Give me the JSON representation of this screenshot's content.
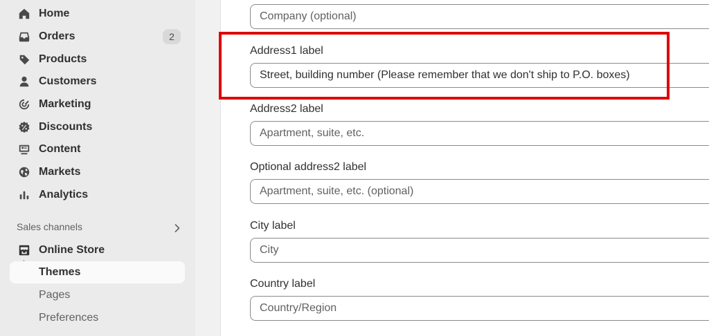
{
  "sidebar": {
    "items": [
      {
        "label": "Home",
        "icon": "home-icon"
      },
      {
        "label": "Orders",
        "icon": "inbox-icon",
        "badge": "2"
      },
      {
        "label": "Products",
        "icon": "tag-icon"
      },
      {
        "label": "Customers",
        "icon": "person-icon"
      },
      {
        "label": "Marketing",
        "icon": "target-icon"
      },
      {
        "label": "Discounts",
        "icon": "discount-icon"
      },
      {
        "label": "Content",
        "icon": "content-icon"
      },
      {
        "label": "Markets",
        "icon": "globe-icon"
      },
      {
        "label": "Analytics",
        "icon": "bar-chart-icon"
      }
    ],
    "sales_channels_label": "Sales channels",
    "online_store_label": "Online Store",
    "sub_items": [
      {
        "label": "Themes",
        "active": true
      },
      {
        "label": "Pages",
        "active": false
      },
      {
        "label": "Preferences",
        "active": false
      }
    ]
  },
  "form": {
    "company_placeholder": "Company (optional)",
    "address1_label": "Address1 label",
    "address1_value": "Street, building number (Please remember that we don't ship to P.O. boxes)",
    "address2_label": "Address2 label",
    "address2_placeholder": "Apartment, suite, etc.",
    "optional_address2_label": "Optional address2 label",
    "optional_address2_placeholder": "Apartment, suite, etc. (optional)",
    "city_label": "City label",
    "city_placeholder": "City",
    "country_label": "Country label",
    "country_placeholder": "Country/Region"
  },
  "colors": {
    "highlight": "#e00000",
    "sidebar_bg": "#ebebeb",
    "active_item_bg": "#fafafa"
  }
}
